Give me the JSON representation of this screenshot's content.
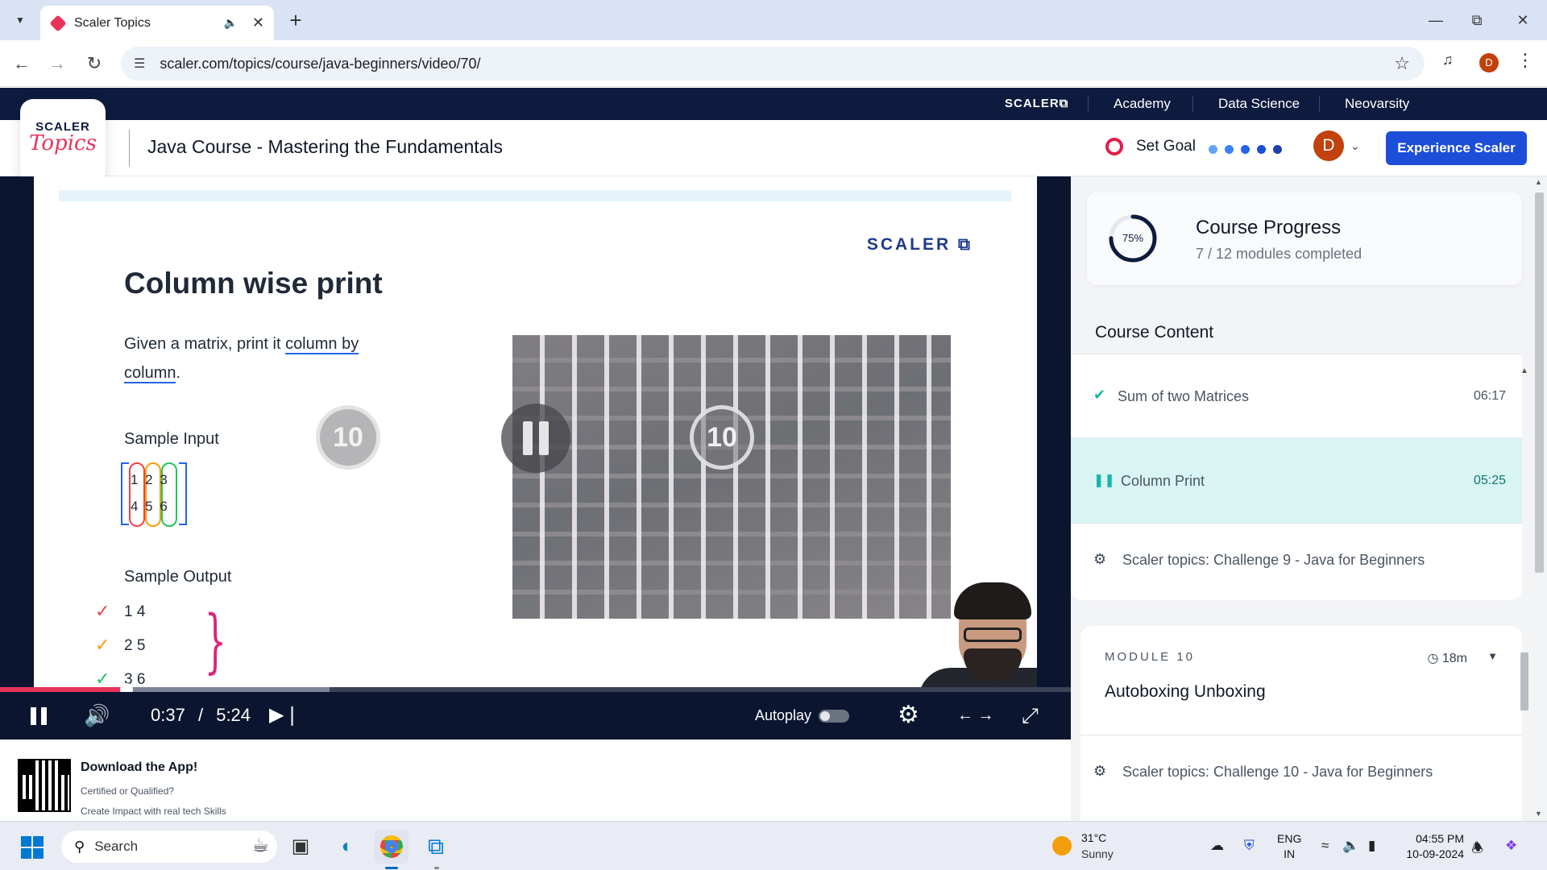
{
  "browser": {
    "tab_title": "Scaler Topics",
    "url": "scaler.com/topics/course/java-beginners/video/70/",
    "profile_initial": "D"
  },
  "topnav": {
    "brand": "SCALER⧉",
    "items": [
      "Academy",
      "Data Science",
      "Neovarsity"
    ]
  },
  "header": {
    "logo_top": "SCALER",
    "logo_bottom": "Topics",
    "course_title": "Java Course - Mastering the Fundamentals",
    "set_goal": "Set Goal",
    "avatar_initial": "D",
    "cta": "Experience Scaler",
    "goal_dot_colors": [
      "#60a5fa",
      "#3b82f6",
      "#2563eb",
      "#1d4ed8",
      "#1e40af"
    ]
  },
  "slide": {
    "logo": "SCALER ⧉",
    "title": "Column wise print",
    "desc_pre": "Given a matrix, print it ",
    "desc_link1": "column by",
    "desc_link2": "column",
    "desc_post": ".",
    "sample_input_label": "Sample Input",
    "matrix_rows": [
      "1 2 3",
      "4 5 6"
    ],
    "sample_output_label": "Sample Output",
    "output_rows": [
      "1 4",
      "2 5",
      "3 6"
    ],
    "seek_back_label": "10",
    "seek_fwd_label": "10"
  },
  "player": {
    "progress_fraction": 0.118,
    "buffered_fraction": 0.308,
    "current_time": "0:37",
    "separator": "/",
    "duration": "5:24",
    "autoplay_label": "Autoplay",
    "autoplay_on": false
  },
  "sidebar": {
    "progress_title": "Course Progress",
    "progress_percent_label": "75%",
    "progress_fraction": 0.75,
    "progress_sub": "7 / 12 modules completed",
    "content_heading": "Course Content",
    "lessons": [
      {
        "title": "Sum of two Matrices",
        "duration": "06:17"
      },
      {
        "title": "Column Print",
        "duration": "05:25"
      },
      {
        "title": "Scaler topics: Challenge 9 - Java for Beginners",
        "duration": ""
      }
    ],
    "module": {
      "kicker": "MODULE 10",
      "title": "Autoboxing Unboxing",
      "time": "18m"
    },
    "next_lesson": "Scaler topics: Challenge 10 - Java for Beginners"
  },
  "app_promo": {
    "title": "Download the App!",
    "line1": "Certified or Qualified?",
    "line2": "Create Impact with real tech Skills"
  },
  "taskbar": {
    "search_placeholder": "Search",
    "weather_temp": "31°C",
    "weather_cond": "Sunny",
    "lang_top": "ENG",
    "lang_bottom": "IN",
    "time": "04:55 PM",
    "date": "10-09-2024"
  }
}
